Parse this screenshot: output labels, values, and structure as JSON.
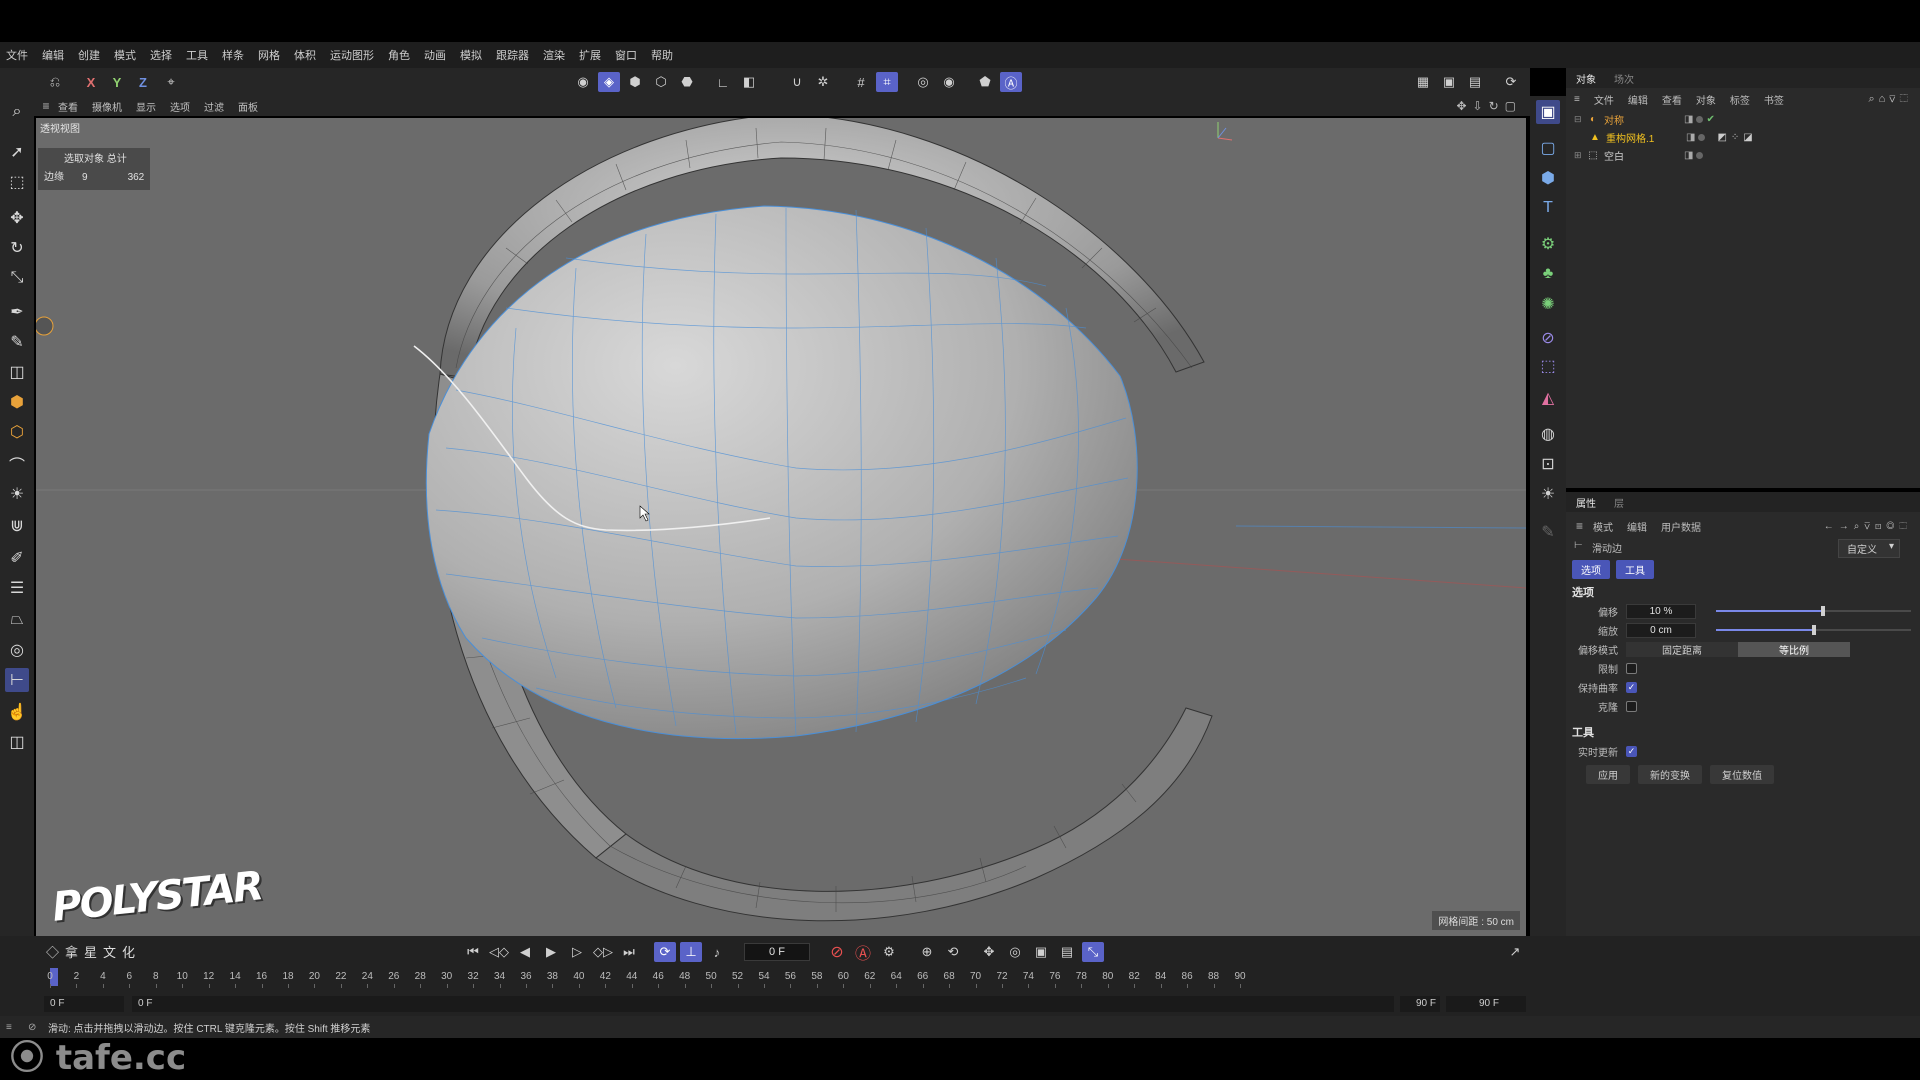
{
  "menubar": [
    "文件",
    "编辑",
    "创建",
    "模式",
    "选择",
    "工具",
    "样条",
    "网格",
    "体积",
    "运动图形",
    "角色",
    "动画",
    "模拟",
    "跟踪器",
    "渲染",
    "扩展",
    "窗口",
    "帮助"
  ],
  "toolbar": {
    "undo_icon": "undo-icon",
    "axis_x": "X",
    "axis_y": "Y",
    "axis_z": "Z"
  },
  "viewport": {
    "menu": [
      "查看",
      "摄像机",
      "显示",
      "选项",
      "过滤",
      "面板"
    ],
    "label": "透视视图",
    "hud_header": "选取对象 总计",
    "hud_row_label": "边缘",
    "hud_row_selected": "9",
    "hud_row_total": "362",
    "grid_spacing": "网格间距 : 50 cm",
    "logo": "POLYSTAR"
  },
  "objects_panel": {
    "tabs": [
      "对象",
      "场次"
    ],
    "menu": [
      "文件",
      "编辑",
      "查看",
      "对象",
      "标签",
      "书签"
    ],
    "items": [
      {
        "name": "对称",
        "color": "#e8a23a"
      },
      {
        "name": "重构网格.1",
        "color": "#f0c020"
      },
      {
        "name": "空白",
        "color": "#d0d0d0"
      }
    ]
  },
  "attributes_panel": {
    "tabs": [
      "属性",
      "层"
    ],
    "menu": [
      "模式",
      "编辑",
      "用户数据"
    ],
    "tool_name": "滑动边",
    "preset": "自定义",
    "sub_tabs": [
      "选项",
      "工具"
    ],
    "options_title": "选项",
    "offset_label": "偏移",
    "offset_value": "10 %",
    "offset_slider": 0.55,
    "scale_label": "缩放",
    "scale_value": "0 cm",
    "scale_slider": 0.5,
    "offset_mode_label": "偏移模式",
    "offset_mode_options": [
      "固定距离",
      "等比例"
    ],
    "offset_mode_selected": "等比例",
    "limit_label": "限制",
    "limit_checked": false,
    "preserve_curvature_label": "保持曲率",
    "preserve_curvature_checked": true,
    "clone_label": "克隆",
    "clone_checked": false,
    "tool_title": "工具",
    "realtime_label": "实时更新",
    "realtime_checked": true,
    "buttons": [
      "应用",
      "新的变换",
      "复位数值"
    ]
  },
  "timeline": {
    "current_frame": "0 F",
    "ticks": [
      "0",
      "2",
      "4",
      "6",
      "8",
      "10",
      "12",
      "14",
      "16",
      "18",
      "20",
      "22",
      "24",
      "26",
      "28",
      "30",
      "32",
      "34",
      "36",
      "38",
      "40",
      "42",
      "44",
      "46",
      "48",
      "50",
      "52",
      "54",
      "56",
      "58",
      "60",
      "62",
      "64",
      "66",
      "68",
      "70",
      "72",
      "74",
      "76",
      "78",
      "80",
      "82",
      "84",
      "86",
      "88",
      "90"
    ],
    "start_frame": "0 F",
    "range_start": "0 F",
    "range_end": "90 F",
    "end_frame": "90 F",
    "logo_chars": "拿星文化"
  },
  "status": {
    "text": "滑动: 点击并拖拽以滑动边。按住 CTRL 键克隆元素。按住 Shift 推移元素"
  },
  "watermark": "tafe.cc",
  "colors": {
    "accent": "#5a63c8",
    "selection_edge": "#4a8fd8",
    "record": "#e85050"
  }
}
